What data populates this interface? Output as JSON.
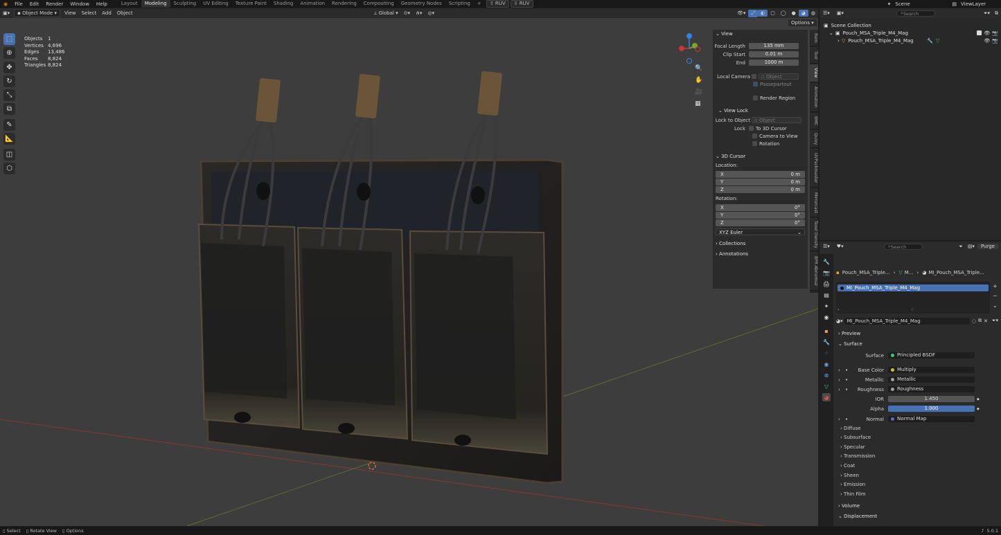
{
  "topbar": {
    "menus": [
      "File",
      "Edit",
      "Render",
      "Window",
      "Help"
    ],
    "workspaces": [
      "Layout",
      "Modeling",
      "Sculpting",
      "UV Editing",
      "Texture Paint",
      "Shading",
      "Animation",
      "Rendering",
      "Compositing",
      "Geometry Nodes",
      "Scripting"
    ],
    "active_workspace": "Modeling",
    "add_tab": "+",
    "ruv1": "RUV",
    "ruv2": "RUV",
    "scene": "Scene",
    "view_layer": "ViewLayer"
  },
  "viewport_header": {
    "mode": "Object Mode",
    "menus": [
      "View",
      "Select",
      "Add",
      "Object"
    ],
    "orientation": "Global",
    "options": "Options"
  },
  "stats": [
    {
      "label": "Objects",
      "value": "1"
    },
    {
      "label": "Vertices",
      "value": "4,696"
    },
    {
      "label": "Edges",
      "value": "13,486"
    },
    {
      "label": "Faces",
      "value": "8,824"
    },
    {
      "label": "Triangles",
      "value": "8,824"
    }
  ],
  "gizmo": {
    "x": "X",
    "y": "Y",
    "z": "Z"
  },
  "npanel": {
    "view_title": "View",
    "focal_length_label": "Focal Length",
    "focal_length": "135 mm",
    "clip_start_label": "Clip Start",
    "clip_start": "0.01 m",
    "end_label": "End",
    "end": "1000 m",
    "local_camera_label": "Local Camera",
    "local_camera_placeholder": "Object",
    "passepartout": "Passepartout",
    "render_region": "Render Region",
    "view_lock_title": "View Lock",
    "lock_to_object_label": "Lock to Object",
    "lock_to_object_placeholder": "Object",
    "lock_label": "Lock",
    "to_3d_cursor": "To 3D Cursor",
    "camera_to_view": "Camera to View",
    "rotation_lock": "Rotation",
    "cursor_title": "3D Cursor",
    "location_label": "Location:",
    "loc": [
      {
        "axis": "X",
        "value": "0 m"
      },
      {
        "axis": "Y",
        "value": "0 m"
      },
      {
        "axis": "Z",
        "value": "0 m"
      }
    ],
    "rotation_label": "Rotation:",
    "rot": [
      {
        "axis": "X",
        "value": "0°"
      },
      {
        "axis": "Y",
        "value": "0°"
      },
      {
        "axis": "Z",
        "value": "0°"
      }
    ],
    "rotation_mode": "XYZ Euler",
    "collections": "Collections",
    "annotations": "Annotations"
  },
  "ntabs": [
    "Item",
    "Tool",
    "View",
    "Animation",
    "BMC",
    "Quixy",
    "UVPackmaster",
    "Mirrorcast",
    "Texel Density",
    "BPR Abnormal"
  ],
  "outliner": {
    "search_placeholder": "Search",
    "scene_collection": "Scene Collection",
    "collection": "Pouch_MSA_Triple_M4_Mag",
    "object": "Pouch_MSA_Triple_M4_Mag"
  },
  "properties": {
    "search_placeholder": "Search",
    "purge": "Purge",
    "breadcrumb_object": "Pouch_MSA_Triple...",
    "breadcrumb_mesh": "M...",
    "breadcrumb_material": "MI_Pouch_MSA_Triple...",
    "slot_material": "MI_Pouch_MSA_Triple_M4_Mag",
    "material_name": "MI_Pouch_MSA_Triple_M4_Mag",
    "preview": "Preview",
    "surface_title": "Surface",
    "surface_label": "Surface",
    "surface_value": "Principled BSDF",
    "base_color_label": "Base Color",
    "base_color_value": "Multiply",
    "metallic_label": "Metallic",
    "metallic_value": "Metallic",
    "roughness_label": "Roughness",
    "roughness_value": "Roughness",
    "ior_label": "IOR",
    "ior_value": "1.450",
    "alpha_label": "Alpha",
    "alpha_value": "1.000",
    "normal_label": "Normal",
    "normal_value": "Normal Map",
    "subpanels": [
      "Diffuse",
      "Subsurface",
      "Specular",
      "Transmission",
      "Coat",
      "Sheen",
      "Emission",
      "Thin Film"
    ],
    "volume": "Volume",
    "displacement": "Displacement"
  },
  "statusbar": {
    "select": "Select",
    "rotate_view": "Rotate View",
    "options": "Options",
    "version": "5.0.1"
  },
  "colors": {
    "accent": "#4772b3",
    "socket_yellow": "#c7c729",
    "socket_grey": "#a1a1a1",
    "socket_blue": "#6363c7",
    "x_axis": "#c9363c",
    "y_axis": "#7aa628",
    "z_axis": "#2f84e3"
  }
}
